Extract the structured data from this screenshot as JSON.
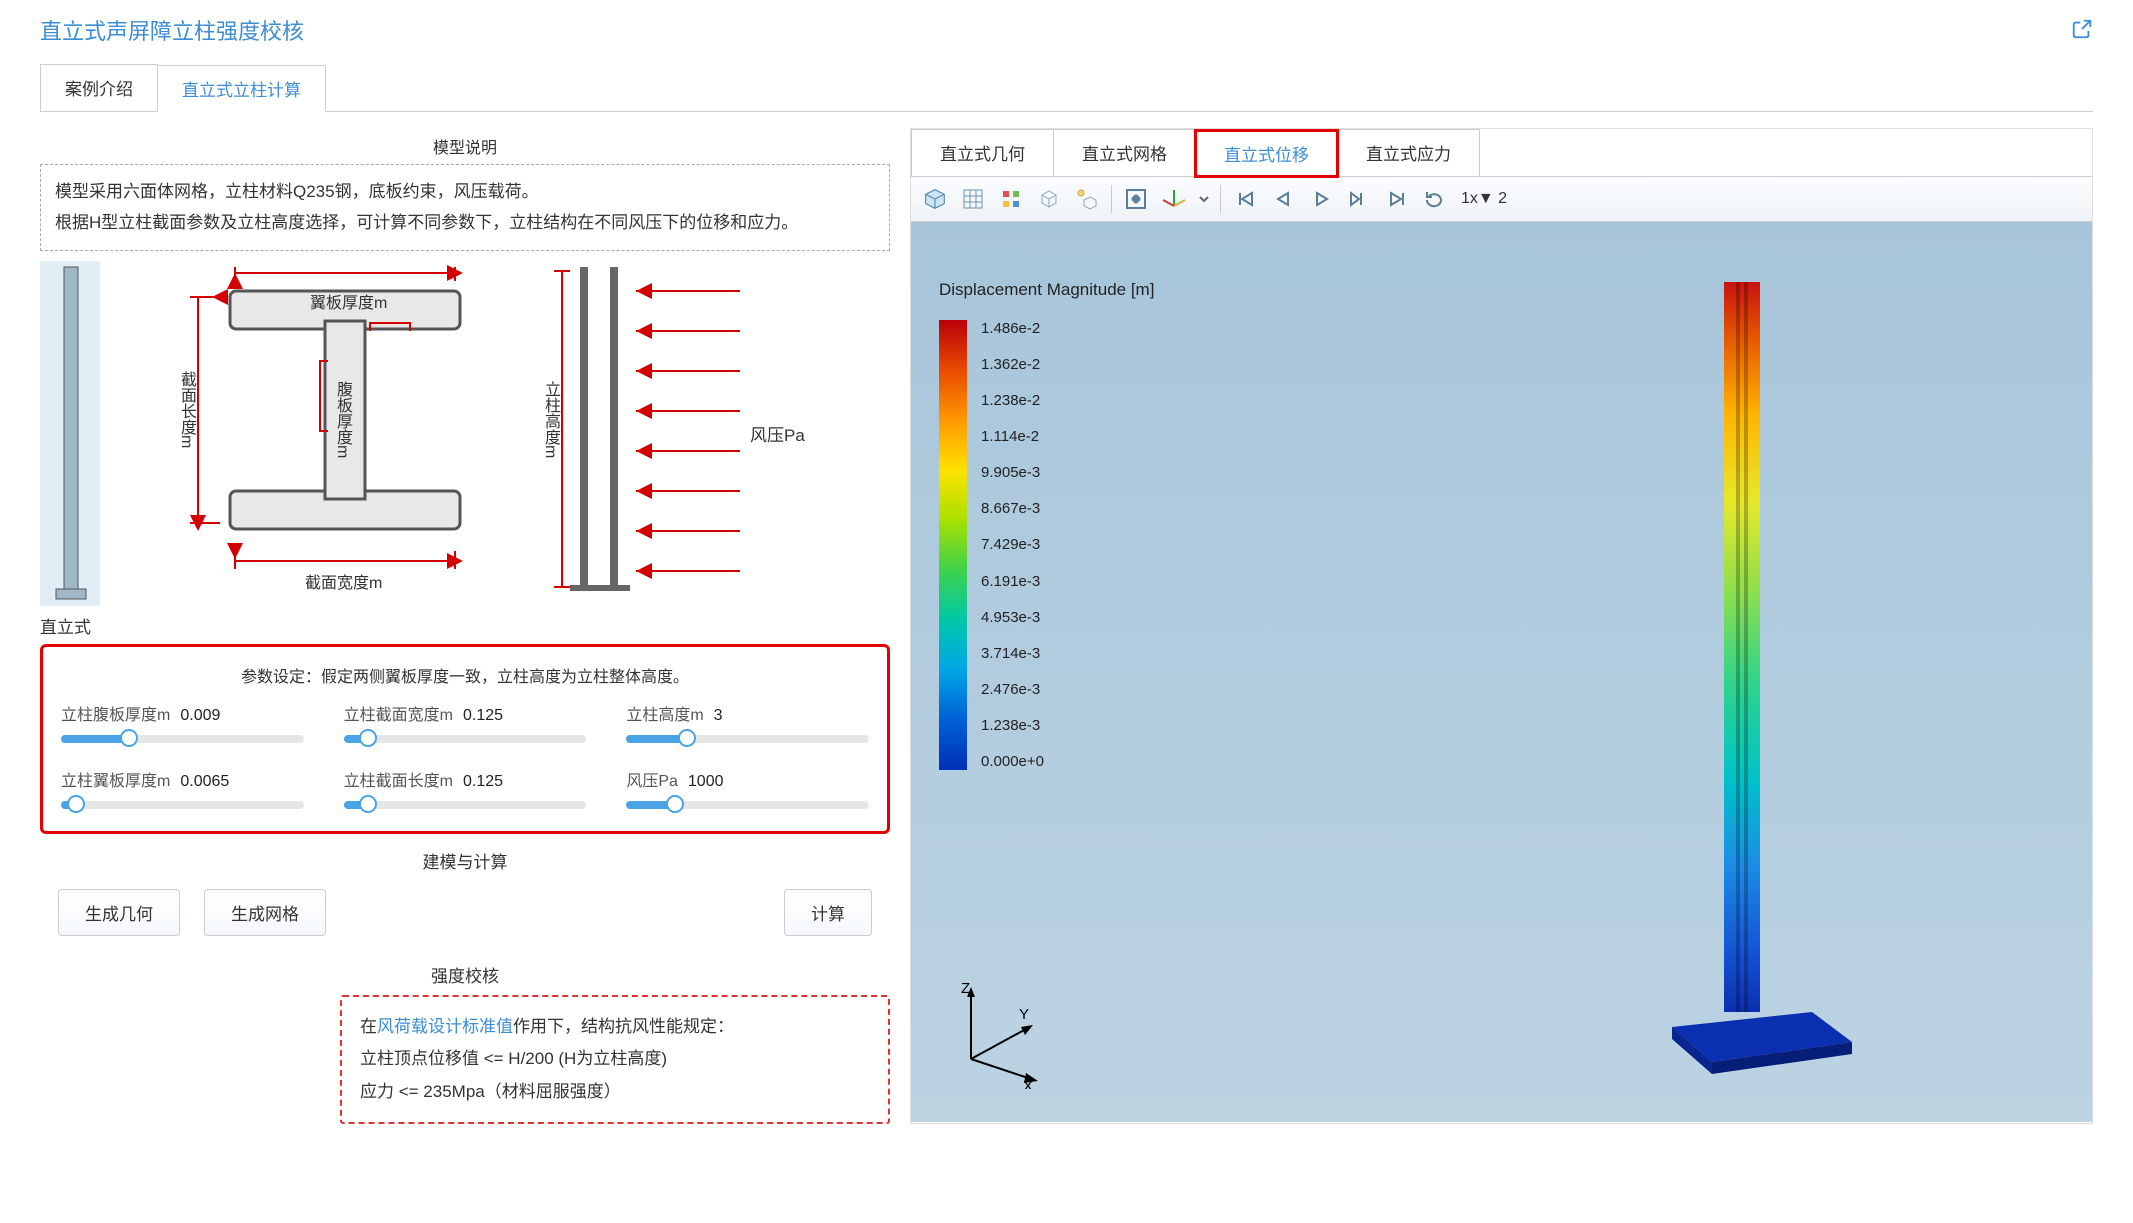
{
  "header": {
    "title": "直立式声屏障立柱强度校核"
  },
  "main_tabs": {
    "case_intro": "案例介绍",
    "calc": "直立式立柱计算",
    "active": "calc"
  },
  "model_desc": {
    "title": "模型说明",
    "line1": "模型采用六面体网格，立柱材料Q235钢，底板约束，风压载荷。",
    "line2": "根据H型立柱截面参数及立柱高度选择，可计算不同参数下，立柱结构在不同风压下的位移和应力。"
  },
  "diagram": {
    "sec_len": "截面长度m",
    "flange_thk": "翼板厚度m",
    "web_thk": "腹板厚度m",
    "sec_width": "截面宽度m",
    "col_height": "立柱高度m",
    "wind_pressure": "风压Pa",
    "caption": "直立式"
  },
  "params": {
    "title": "参数设定：假定两侧翼板厚度一致，立柱高度为立柱整体高度。",
    "web_thk": {
      "label": "立柱腹板厚度m",
      "value": "0.009",
      "pct": 28
    },
    "sec_width": {
      "label": "立柱截面宽度m",
      "value": "0.125",
      "pct": 10
    },
    "height": {
      "label": "立柱高度m",
      "value": "3",
      "pct": 25
    },
    "flange_thk": {
      "label": "立柱翼板厚度m",
      "value": "0.0065",
      "pct": 6
    },
    "sec_len": {
      "label": "立柱截面长度m",
      "value": "0.125",
      "pct": 10
    },
    "wind": {
      "label": "风压Pa",
      "value": "1000",
      "pct": 20
    }
  },
  "build": {
    "title": "建模与计算",
    "gen_geom": "生成几何",
    "gen_mesh": "生成网格",
    "compute": "计算"
  },
  "strength": {
    "title": "强度校核",
    "prefix": "在",
    "link": "风荷载设计标准值",
    "suffix": "作用下，结构抗风性能规定：",
    "line2": "立柱顶点位移值 <= H/200 (H为立柱高度)",
    "line3": "应力 <= 235Mpa（材料屈服强度）"
  },
  "right_tabs": {
    "geom": "直立式几何",
    "mesh": "直立式网格",
    "disp": "直立式位移",
    "stress": "直立式应力",
    "active": "disp"
  },
  "toolbar": {
    "frame_text": "1x▼ 2"
  },
  "legend": {
    "title": "Displacement Magnitude [m]",
    "ticks": [
      "1.486e-2",
      "1.362e-2",
      "1.238e-2",
      "1.114e-2",
      "9.905e-3",
      "8.667e-3",
      "7.429e-3",
      "6.191e-3",
      "4.953e-3",
      "3.714e-3",
      "2.476e-3",
      "1.238e-3",
      "0.000e+0"
    ]
  },
  "axes": {
    "x": "X",
    "y": "Y",
    "z": "Z"
  }
}
